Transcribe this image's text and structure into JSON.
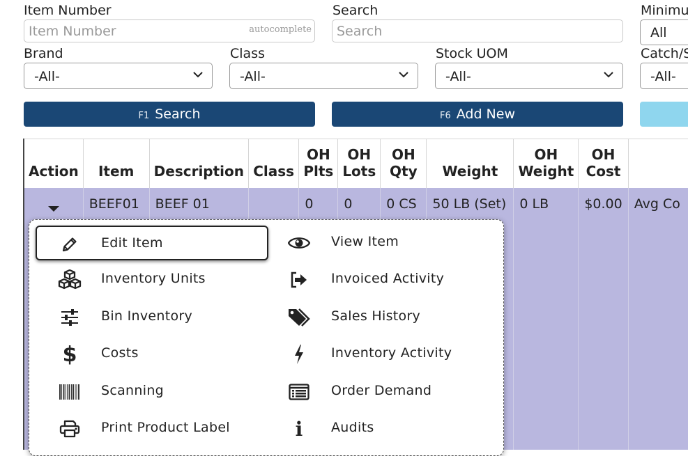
{
  "filters": {
    "item_number_label": "Item Number",
    "item_number_placeholder": "Item Number",
    "autocomplete_hint": "autocomplete",
    "search_label": "Search",
    "search_placeholder": "Search",
    "minimum_label": "Minimu",
    "minimum_value": "All",
    "brand_label": "Brand",
    "brand_value": "-All-",
    "class_label": "Class",
    "class_value": "-All-",
    "stock_uom_label": "Stock UOM",
    "stock_uom_value": "-All-",
    "catch_label": "Catch/S",
    "catch_value": "-All-"
  },
  "buttons": {
    "search_key": "F1",
    "search_label": "Search",
    "add_key": "F6",
    "add_label": "Add New"
  },
  "table": {
    "headers": {
      "action": "Action",
      "item": "Item",
      "description": "Description",
      "class": "Class",
      "oh": "OH",
      "plts": "Plts",
      "lots": "Lots",
      "qty": "Qty",
      "weight": "Weight",
      "weight2": "Weight",
      "cost": "Cost"
    },
    "row": {
      "item": "BEEF01",
      "description": "BEEF 01",
      "class": "",
      "oh_plts": "0",
      "oh_lots": "0",
      "oh_qty": "0 CS",
      "weight": "50 LB (Set)",
      "oh_weight": "0 LB",
      "oh_cost": "$0.00",
      "costing": "Avg Co"
    }
  },
  "menu": {
    "left": [
      {
        "label": "Edit Item",
        "icon": "pencil-icon"
      },
      {
        "label": "Inventory Units",
        "icon": "cubes-icon"
      },
      {
        "label": "Bin Inventory",
        "icon": "sliders-icon"
      },
      {
        "label": "Costs",
        "icon": "dollar-icon"
      },
      {
        "label": "Scanning",
        "icon": "barcode-icon"
      },
      {
        "label": "Print Product Label",
        "icon": "printer-icon"
      }
    ],
    "right": [
      {
        "label": "View Item",
        "icon": "eye-icon"
      },
      {
        "label": "Invoiced Activity",
        "icon": "sign-out-icon"
      },
      {
        "label": "Sales History",
        "icon": "tags-icon"
      },
      {
        "label": "Inventory Activity",
        "icon": "bolt-icon"
      },
      {
        "label": "Order Demand",
        "icon": "list-alt-icon"
      },
      {
        "label": "Audits",
        "icon": "info-icon"
      }
    ]
  }
}
